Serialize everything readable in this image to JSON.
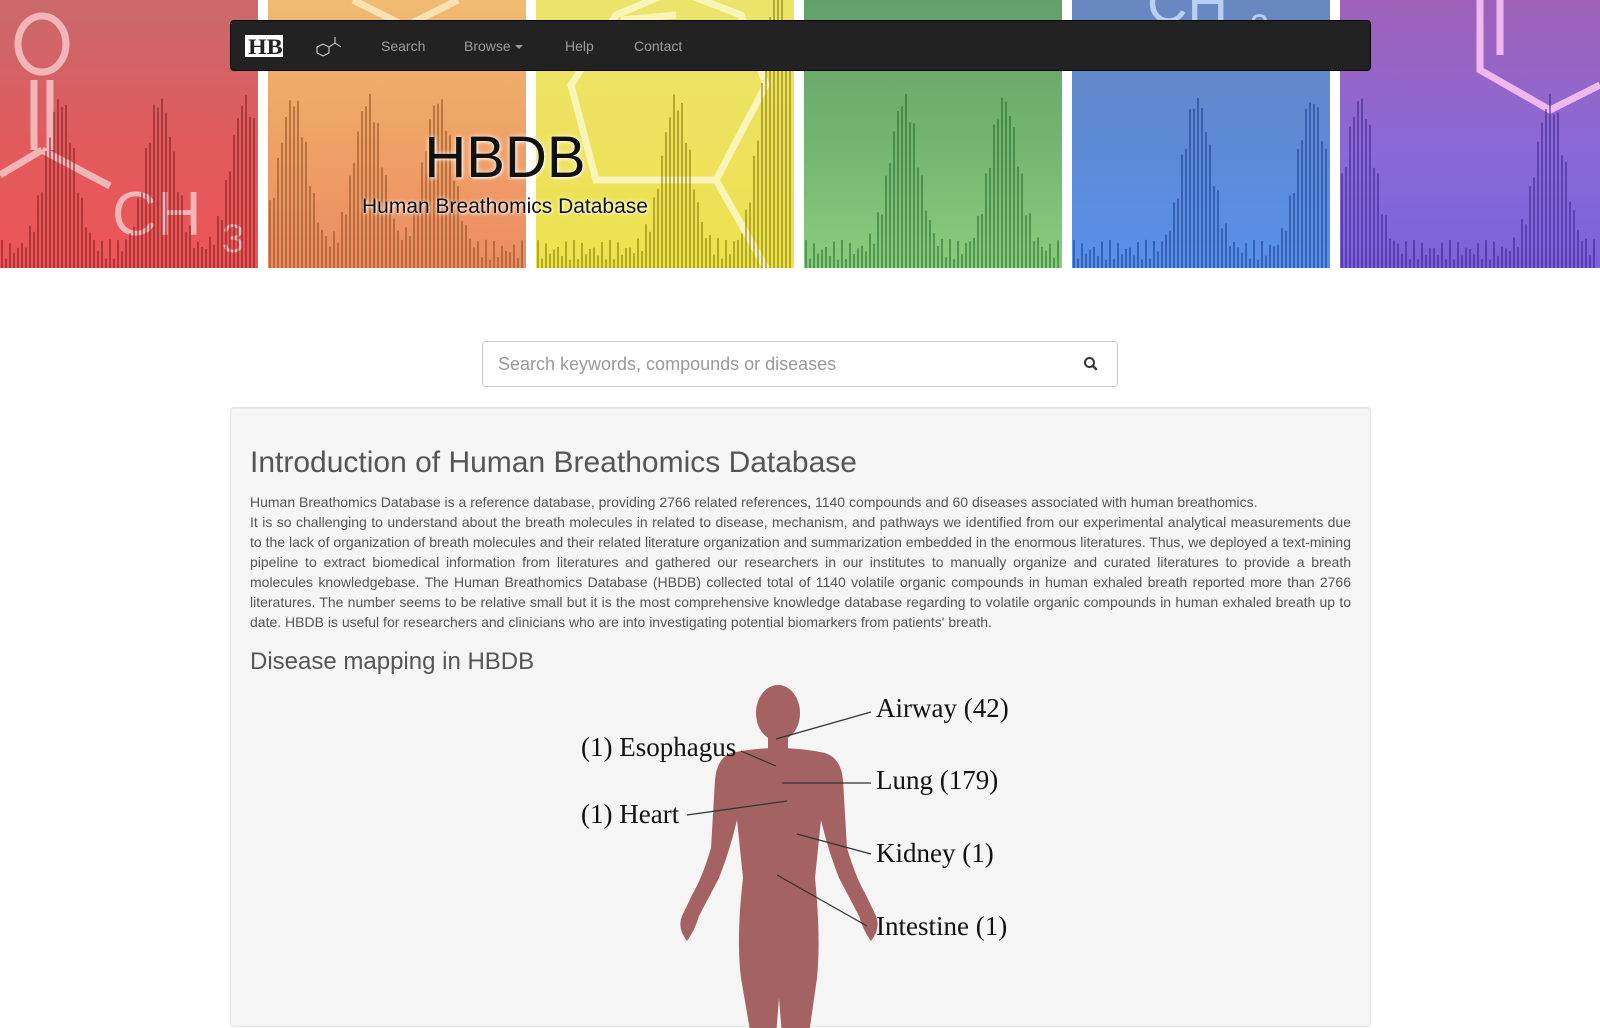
{
  "nav": {
    "brand": "HBDB",
    "search": "Search",
    "browse": "Browse",
    "help": "Help",
    "contact": "Contact"
  },
  "hero": {
    "title": "HBDB",
    "subtitle": "Human Breathomics Database"
  },
  "search": {
    "placeholder": "Search keywords, compounds or diseases"
  },
  "intro": {
    "heading": "Introduction of Human Breathomics Database",
    "paragraph1": "Human Breathomics Database is a reference database, providing 2766 related references, 1140 compounds and 60 diseases associated with human breathomics.",
    "paragraph2": "It is so challenging to understand about the breath molecules in related to disease, mechanism, and pathways we identified from our experimental analytical measurements due to the lack of organization of breath molecules and their related literature organization and summarization embedded in the enormous literatures. Thus, we deployed a text-mining pipeline to extract biomedical information from literatures and gathered our researchers in our institutes to manually organize and curated literatures to provide a breath molecules knowledgebase. The Human Breathomics Database (HBDB) collected total of 1140 volatile organic compounds in human exhaled breath reported more than 2766 literatures. The number seems to be relative small but it is the most comprehensive knowledge database regarding to volatile organic compounds in human exhaled breath up to date. HBDB is useful for researchers and clinicians who are into investigating potential biomarkers from patients' breath."
  },
  "disease_map": {
    "heading": "Disease mapping in HBDB",
    "organs": {
      "airway": "Airway (42)",
      "esophagus": "(1) Esophagus",
      "lung": "Lung (179)",
      "heart": "(1) Heart",
      "kidney": "Kidney (1)",
      "intestine": "Intestine (1)"
    }
  },
  "colors": {
    "navbar": "#222222",
    "nav_text": "#9d9d9d",
    "well": "#f5f5f5",
    "body_silhouette": "#a56262",
    "strip_red": "#e8585a",
    "strip_orange": "#eda06a",
    "strip_yellow": "#ece65a",
    "strip_green": "#7fc07a",
    "strip_blue": "#5b8de0",
    "strip_purple": "#8a6ad8"
  }
}
